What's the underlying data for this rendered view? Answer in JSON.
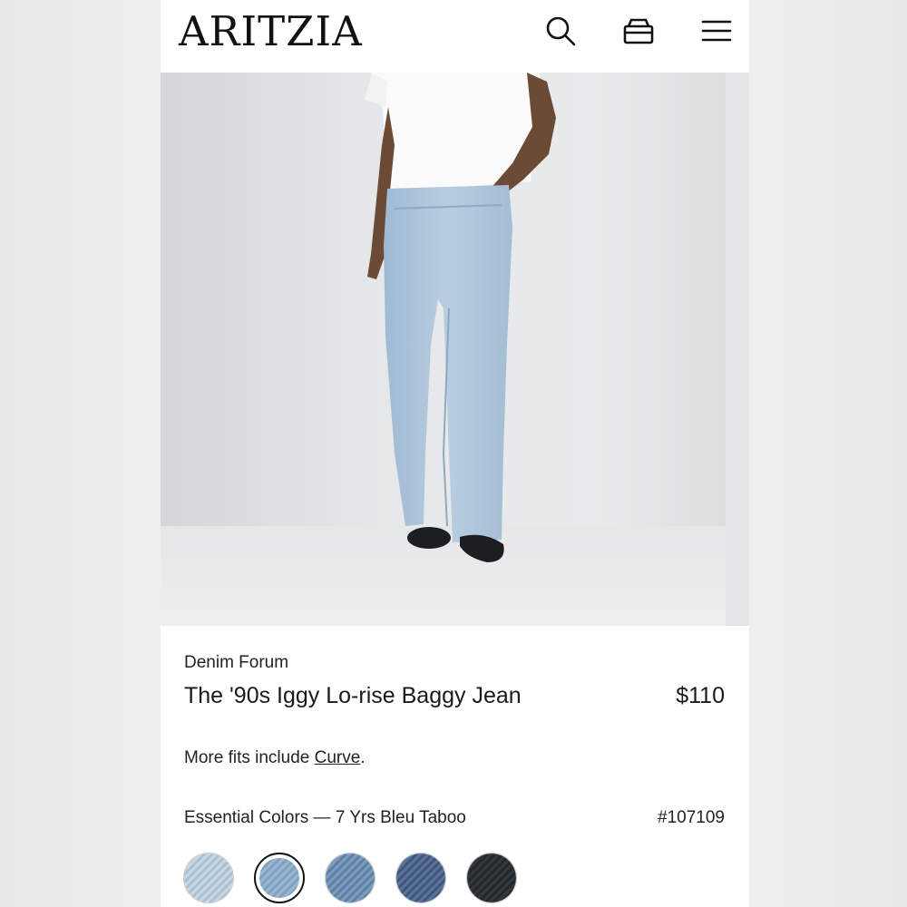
{
  "header": {
    "logo": "ARITZIA",
    "icons": [
      "search-icon",
      "bag-icon",
      "menu-icon"
    ]
  },
  "product": {
    "brand": "Denim Forum",
    "title": "The '90s Iggy Lo-rise Baggy Jean",
    "price": "$110",
    "fits_prefix": "More fits include ",
    "fits_link": "Curve",
    "fits_suffix": ".",
    "color_label": "Essential Colors — 7 Yrs Bleu Taboo",
    "sku": "#107109",
    "swatches": [
      {
        "name": "light-wash",
        "color": "#b9cad8",
        "selected": false
      },
      {
        "name": "bleu-taboo",
        "color": "#8eaccb",
        "selected": true
      },
      {
        "name": "medium-wash",
        "color": "#6f8fb2",
        "selected": false
      },
      {
        "name": "dark-wash",
        "color": "#4b6485",
        "selected": false
      },
      {
        "name": "black-wash",
        "color": "#2c2f35",
        "selected": false
      }
    ]
  },
  "colors": {
    "background": "#ffffff",
    "text": "#1a1a1a",
    "denim": "#a9c3da",
    "shirt": "#fafafa"
  }
}
